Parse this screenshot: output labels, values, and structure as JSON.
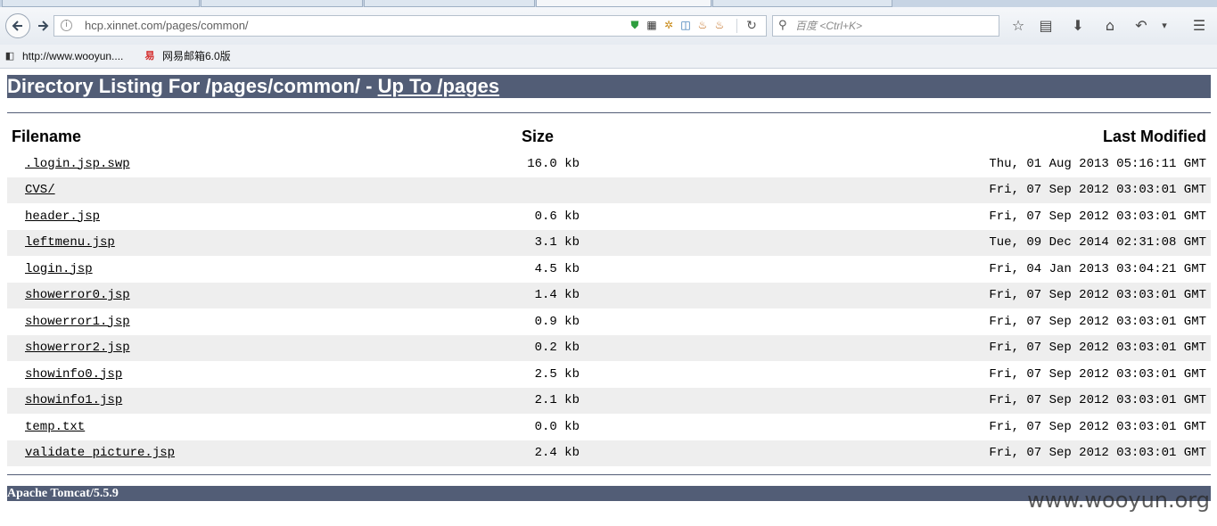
{
  "browser": {
    "url": "hcp.xinnet.com/pages/common/",
    "search_placeholder": "百度 <Ctrl+K>",
    "bookmarks": [
      {
        "label": "http://www.wooyun...."
      },
      {
        "label": "网易邮箱6.0版"
      }
    ]
  },
  "page": {
    "title_prefix": "Directory Listing For /pages/common/ - ",
    "title_link": "Up To /pages",
    "columns": {
      "filename": "Filename",
      "size": "Size",
      "modified": "Last Modified"
    },
    "files": [
      {
        "name": ".login.jsp.swp",
        "size": "16.0 kb",
        "modified": "Thu, 01 Aug 2013 05:16:11 GMT"
      },
      {
        "name": "CVS/",
        "size": "",
        "modified": "Fri, 07 Sep 2012 03:03:01 GMT"
      },
      {
        "name": "header.jsp",
        "size": "0.6 kb",
        "modified": "Fri, 07 Sep 2012 03:03:01 GMT"
      },
      {
        "name": "leftmenu.jsp",
        "size": "3.1 kb",
        "modified": "Tue, 09 Dec 2014 02:31:08 GMT"
      },
      {
        "name": "login.jsp",
        "size": "4.5 kb",
        "modified": "Fri, 04 Jan 2013 03:04:21 GMT"
      },
      {
        "name": "showerror0.jsp",
        "size": "1.4 kb",
        "modified": "Fri, 07 Sep 2012 03:03:01 GMT"
      },
      {
        "name": "showerror1.jsp",
        "size": "0.9 kb",
        "modified": "Fri, 07 Sep 2012 03:03:01 GMT"
      },
      {
        "name": "showerror2.jsp",
        "size": "0.2 kb",
        "modified": "Fri, 07 Sep 2012 03:03:01 GMT"
      },
      {
        "name": "showinfo0.jsp",
        "size": "2.5 kb",
        "modified": "Fri, 07 Sep 2012 03:03:01 GMT"
      },
      {
        "name": "showinfo1.jsp",
        "size": "2.1 kb",
        "modified": "Fri, 07 Sep 2012 03:03:01 GMT"
      },
      {
        "name": "temp.txt",
        "size": "0.0 kb",
        "modified": "Fri, 07 Sep 2012 03:03:01 GMT"
      },
      {
        "name": "validate_picture.jsp",
        "size": "2.4 kb",
        "modified": "Fri, 07 Sep 2012 03:03:01 GMT"
      }
    ],
    "footer": "Apache Tomcat/5.5.9"
  },
  "watermark": "www.wooyun.org",
  "colors": {
    "header_bar": "#525d76",
    "alt_row": "#eeeeee"
  }
}
